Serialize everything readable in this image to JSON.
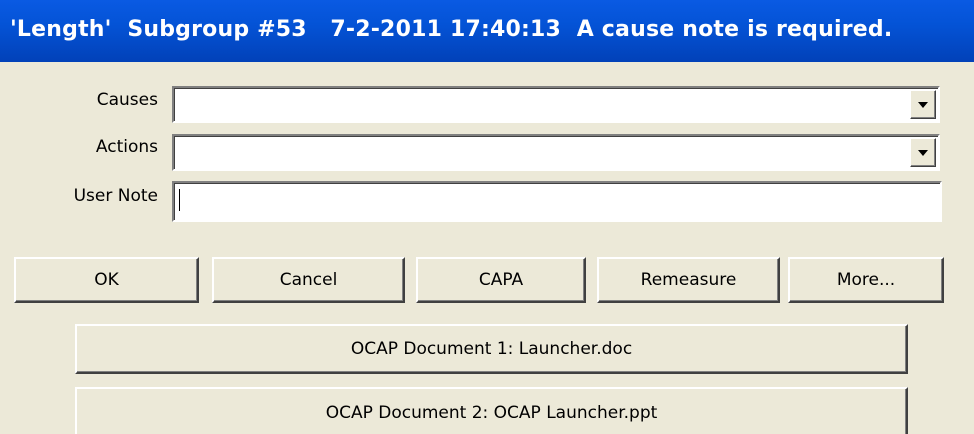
{
  "window": {
    "title": "'Length'  Subgroup #53   7-2-2011 17:40:13  A cause note is required."
  },
  "form": {
    "causes_label": "Causes",
    "causes_value": "",
    "actions_label": "Actions",
    "actions_value": "",
    "user_note_label": "User Note",
    "user_note_value": ""
  },
  "buttons": {
    "ok": "OK",
    "cancel": "Cancel",
    "capa": "CAPA",
    "remeasure": "Remeasure",
    "more": "More..."
  },
  "documents": {
    "doc1": "OCAP Document 1: Launcher.doc",
    "doc2": "OCAP Document 2: OCAP Launcher.ppt"
  },
  "colors": {
    "titlebar": "#0453d6",
    "window_bg": "#ece9d8"
  },
  "icons": {
    "dropdown_arrow": "chevron-down-icon"
  }
}
